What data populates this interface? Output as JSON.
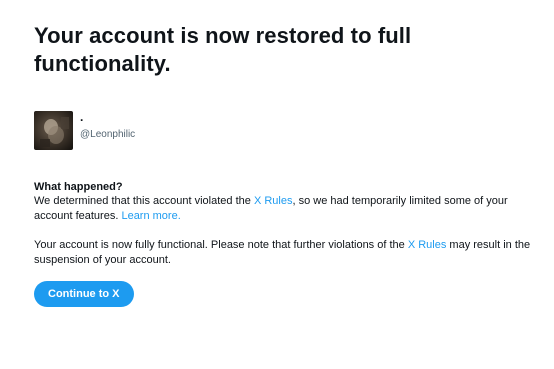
{
  "headline": "Your account is now restored to full functionality.",
  "account": {
    "display_name": ".",
    "handle": "@Leonphilic"
  },
  "what_happened": {
    "title": "What happened?",
    "text_1": "We determined that this account violated the ",
    "link_rules": "X Rules",
    "text_2": ", so we had temporarily limited some of your account features. ",
    "link_learn_more": "Learn more."
  },
  "status": {
    "text_1": "Your account is now fully functional. Please note that further violations of the ",
    "link_rules": "X Rules",
    "text_2": " may result in the suspension of your account."
  },
  "button": {
    "label": "Continue to X"
  },
  "colors": {
    "accent": "#1d9bf0",
    "text": "#0f1419",
    "secondary_text": "#536471"
  }
}
